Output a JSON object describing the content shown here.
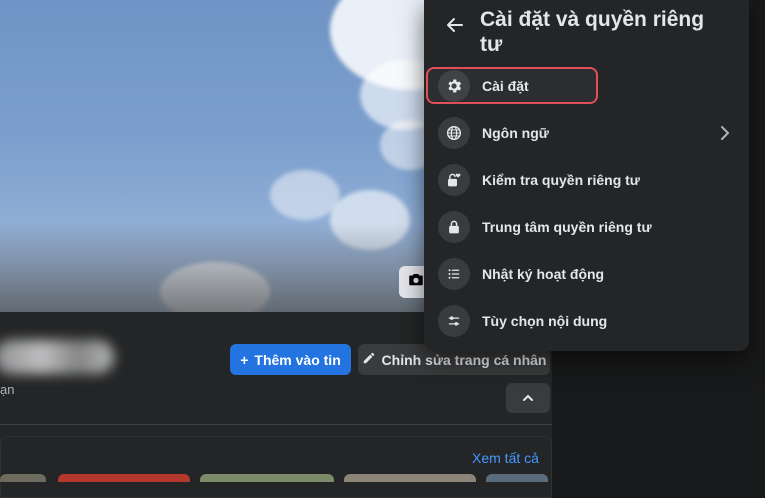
{
  "cover": {
    "camera_icon": "camera-icon"
  },
  "profile": {
    "friends_fragment": "ạn",
    "add_story_label": "Thêm vào tin",
    "add_story_icon": "+",
    "edit_profile_label": "Chỉnh sửa trang cá nhân",
    "edit_icon": "pencil-icon",
    "see_all_label": "Xem tất cả"
  },
  "menu": {
    "title": "Cài đặt và quyền riêng tư",
    "items": [
      {
        "label": "Cài đặt",
        "icon": "gear-icon"
      },
      {
        "label": "Ngôn ngữ",
        "icon": "globe-icon"
      },
      {
        "label": "Kiểm tra quyền riêng tư",
        "icon": "lock-heart-icon"
      },
      {
        "label": "Trung tâm quyền riêng tư",
        "icon": "lock-icon"
      },
      {
        "label": "Nhật ký hoạt động",
        "icon": "list-icon"
      },
      {
        "label": "Tùy chọn nội dung",
        "icon": "sliders-icon"
      }
    ]
  },
  "colors": {
    "accent": "#2374e1",
    "highlight": "#e0505a",
    "panel": "#242526"
  }
}
